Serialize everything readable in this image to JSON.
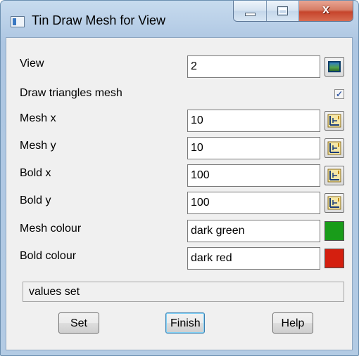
{
  "window": {
    "title": "Tin Draw Mesh for View",
    "caption_buttons": {
      "minimize": "minimize",
      "maximize": "maximize",
      "close": "x"
    }
  },
  "form": {
    "view": {
      "label": "View",
      "value": "2",
      "button_icon": "view-picker-icon"
    },
    "draw_triangles": {
      "label": "Draw triangles mesh",
      "checked": true,
      "check_glyph": "✓"
    },
    "mesh_x": {
      "label": "Mesh x",
      "value": "10",
      "button_icon": "value-picker-icon"
    },
    "mesh_y": {
      "label": "Mesh y",
      "value": "10",
      "button_icon": "value-picker-icon"
    },
    "bold_x": {
      "label": "Bold x",
      "value": "100",
      "button_icon": "value-picker-icon"
    },
    "bold_y": {
      "label": "Bold y",
      "value": "100",
      "button_icon": "value-picker-icon"
    },
    "mesh_colour": {
      "label": "Mesh colour",
      "value": "dark green",
      "swatch_color": "#199c1a"
    },
    "bold_colour": {
      "label": "Bold colour",
      "value": "dark red",
      "swatch_color": "#d41f0f"
    }
  },
  "status": {
    "text": "values set"
  },
  "buttons": {
    "set": "Set",
    "finish": "Finish",
    "help": "Help"
  }
}
